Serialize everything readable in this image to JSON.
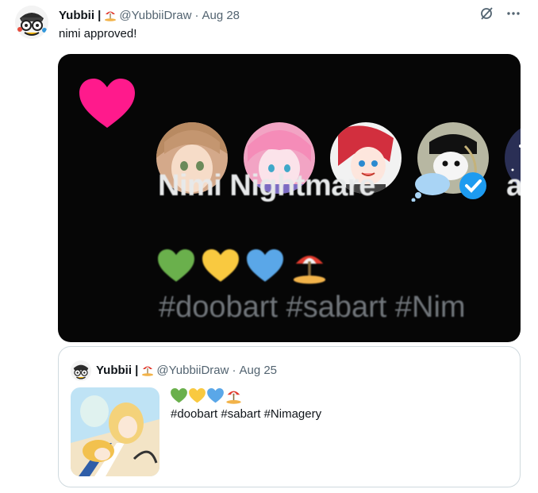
{
  "tweet": {
    "author": {
      "name": "Yubbii |",
      "handle": "@YubbiiDraw",
      "date": "Aug 28",
      "name_emoji": "beach-umbrella"
    },
    "text": "nimi approved!",
    "actions": {
      "grok_icon": "grok-icon",
      "more_icon": "more-icon"
    },
    "media": {
      "profile_name": "Nimi Nightmare",
      "trailing_text": "a",
      "hashtags_visible": "#doobart #sabart #Nim",
      "heart_colors": [
        "#ff1a8c",
        "#6ab04c",
        "#f9c940",
        "#5aa7e8"
      ]
    }
  },
  "quoted": {
    "author": {
      "name": "Yubbii |",
      "handle": "@YubbiiDraw",
      "date": "Aug 25",
      "name_emoji": "beach-umbrella"
    },
    "hearts": [
      "green-heart",
      "yellow-heart",
      "blue-heart",
      "beach-umbrella"
    ],
    "text": "#doobart #sabart #Nimagery"
  },
  "colors": {
    "secondary_text": "#536471",
    "border": "#cfd9de",
    "media_bg": "#060606"
  }
}
